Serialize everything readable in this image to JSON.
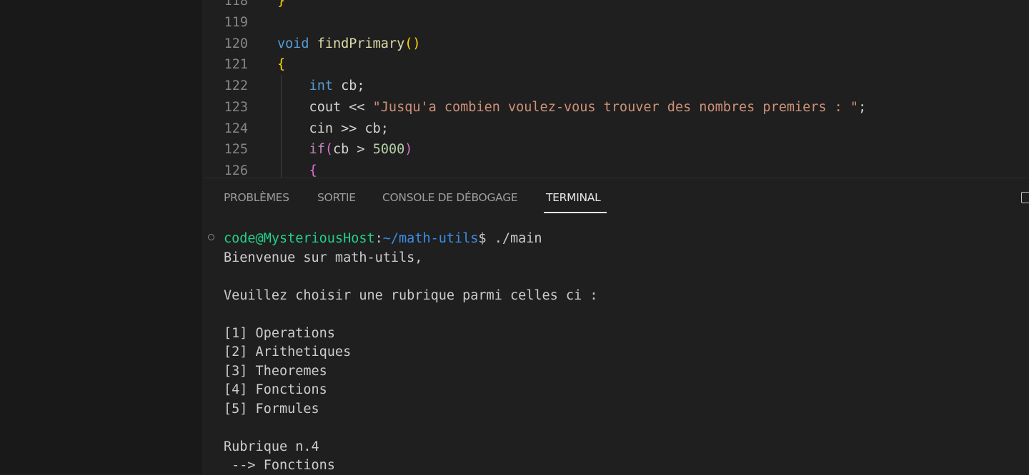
{
  "editor": {
    "lines": [
      {
        "num": "118",
        "tokens": [
          {
            "t": "}",
            "c": "br1"
          }
        ]
      },
      {
        "num": "119",
        "tokens": []
      },
      {
        "num": "120",
        "tokens": [
          {
            "t": "void",
            "c": "kw"
          },
          {
            "t": " "
          },
          {
            "t": "findPrimary",
            "c": "fn"
          },
          {
            "t": "()",
            "c": "br1"
          }
        ]
      },
      {
        "num": "121",
        "tokens": [
          {
            "t": "{",
            "c": "br1"
          }
        ]
      },
      {
        "num": "122",
        "tokens": [
          {
            "t": "    "
          },
          {
            "t": "int",
            "c": "kw"
          },
          {
            "t": " cb;"
          }
        ]
      },
      {
        "num": "123",
        "tokens": [
          {
            "t": "    cout << "
          },
          {
            "t": "\"Jusqu'a combien voulez-vous trouver des nombres premiers : \"",
            "c": "str"
          },
          {
            "t": ";"
          }
        ]
      },
      {
        "num": "124",
        "tokens": [
          {
            "t": "    cin >> cb;"
          }
        ]
      },
      {
        "num": "125",
        "tokens": [
          {
            "t": "    "
          },
          {
            "t": "if",
            "c": "ctl"
          },
          {
            "t": "(",
            "c": "br2"
          },
          {
            "t": "cb > "
          },
          {
            "t": "5000",
            "c": "num"
          },
          {
            "t": ")",
            "c": "br2"
          }
        ]
      },
      {
        "num": "126",
        "tokens": [
          {
            "t": "    "
          },
          {
            "t": "{",
            "c": "br2"
          }
        ]
      }
    ]
  },
  "panel": {
    "tabs": [
      "PROBLÈMES",
      "SORTIE",
      "CONSOLE DE DÉBOGAGE",
      "TERMINAL"
    ],
    "active_tab": "TERMINAL"
  },
  "terminal": {
    "prompt": {
      "user_host": "code@MysteriousHost",
      "colon": ":",
      "path": "~/math-utils",
      "command": "$ ./main"
    },
    "lines": [
      "Bienvenue sur math-utils,",
      "",
      "Veuillez choisir une rubrique parmi celles ci :",
      "",
      "[1] Operations",
      "[2] Arithetiques",
      "[3] Theoremes",
      "[4] Fonctions",
      "[5] Formules",
      "",
      "Rubrique n.4",
      " --> Fonctions"
    ]
  },
  "icons": {
    "panel_toggle": "panel-maximize-icon",
    "status_circle": "terminal-status-circle-icon"
  }
}
